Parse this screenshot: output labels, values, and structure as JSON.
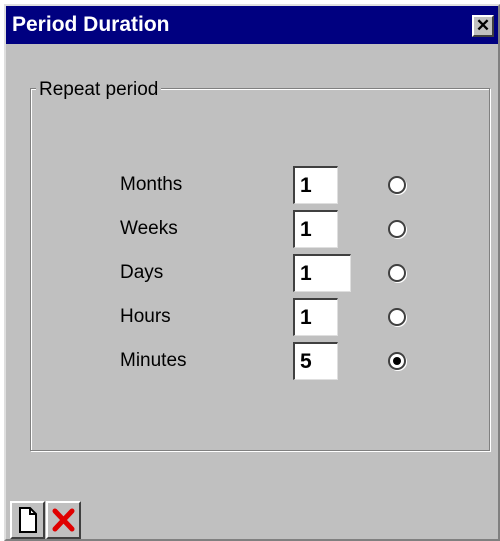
{
  "window": {
    "title": "Period Duration",
    "close_glyph": "✕"
  },
  "group": {
    "legend": "Repeat period"
  },
  "rows": [
    {
      "label": "Months",
      "value": "1",
      "selected": false
    },
    {
      "label": "Weeks",
      "value": "1",
      "selected": false
    },
    {
      "label": "Days",
      "value": "1",
      "selected": false
    },
    {
      "label": "Hours",
      "value": "1",
      "selected": false
    },
    {
      "label": "Minutes",
      "value": "5",
      "selected": true
    }
  ],
  "toolbar": {
    "new_icon": "new-document-icon",
    "delete_icon": "delete-x-icon",
    "delete_color": "#e00000"
  },
  "colors": {
    "titlebar": "#000080",
    "face": "#c0c0c0"
  }
}
